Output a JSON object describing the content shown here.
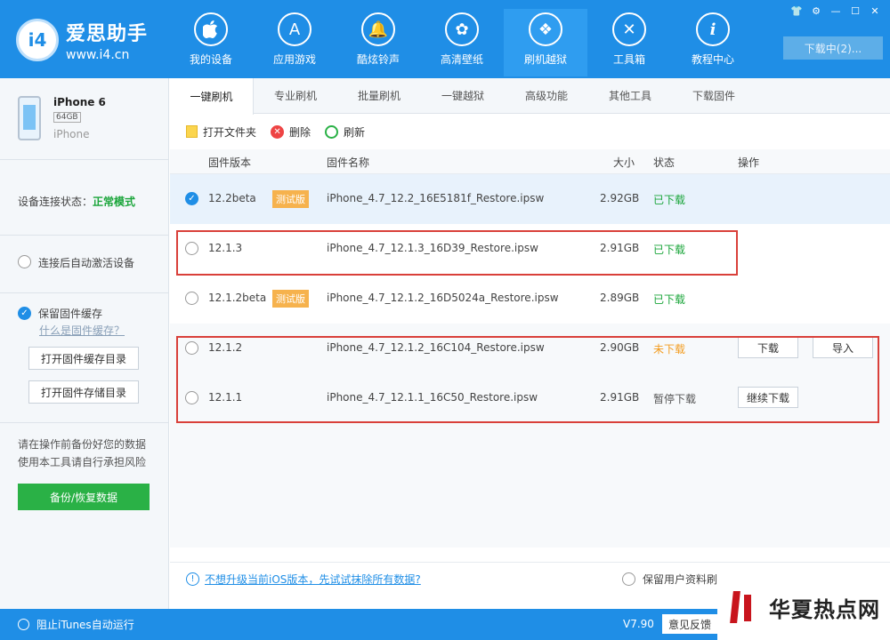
{
  "app": {
    "logo_mark": "i4",
    "logo_title": "爱思助手",
    "logo_url": "www.i4.cn"
  },
  "nav": [
    {
      "label": "我的设备",
      "icon": "apple-icon",
      "glyph": "",
      "active": false
    },
    {
      "label": "应用游戏",
      "icon": "app-store-icon",
      "glyph": "A",
      "active": false
    },
    {
      "label": "酷炫铃声",
      "icon": "bell-icon",
      "glyph": "🔔",
      "active": false
    },
    {
      "label": "高清壁纸",
      "icon": "flower-icon",
      "glyph": "✿",
      "active": false
    },
    {
      "label": "刷机越狱",
      "icon": "dropbox-icon",
      "glyph": "❖",
      "active": true
    },
    {
      "label": "工具箱",
      "icon": "tools-icon",
      "glyph": "✕",
      "active": false
    },
    {
      "label": "教程中心",
      "icon": "info-icon",
      "glyph": "i",
      "active": false
    }
  ],
  "window_controls": [
    "👕",
    "⚙",
    "—",
    "☐",
    "✕"
  ],
  "download_button": "下载中(2)...",
  "device": {
    "name": "iPhone 6",
    "capacity": "64GB",
    "model": "iPhone"
  },
  "connection": {
    "label": "设备连接状态：",
    "value": "正常模式"
  },
  "auto_activate": "连接后自动激活设备",
  "cache": {
    "label": "保留固件缓存",
    "link": "什么是固件缓存？",
    "btn_open_cache": "打开固件缓存目录",
    "btn_open_storage": "打开固件存储目录"
  },
  "warning": [
    "请在操作前备份好您的数据",
    "使用本工具请自行承担风险"
  ],
  "backup_button": "备份/恢复数据",
  "tabs": [
    "一键刷机",
    "专业刷机",
    "批量刷机",
    "一键越狱",
    "高级功能",
    "其他工具",
    "下载固件"
  ],
  "toolbar": {
    "open_folder": "打开文件夹",
    "delete": "删除",
    "refresh": "刷新"
  },
  "columns": {
    "version": "固件版本",
    "name": "固件名称",
    "size": "大小",
    "status": "状态",
    "action": "操作"
  },
  "rows": [
    {
      "version": "12.2beta",
      "beta": "测试版",
      "name": "iPhone_4.7_12.2_16E5181f_Restore.ipsw",
      "size": "2.92GB",
      "status": "已下载",
      "selected": true
    },
    {
      "version": "12.1.3",
      "beta": "",
      "name": "iPhone_4.7_12.1.3_16D39_Restore.ipsw",
      "size": "2.91GB",
      "status": "已下载",
      "selected": false
    },
    {
      "version": "12.1.2beta",
      "beta": "测试版",
      "name": "iPhone_4.7_12.1.2_16D5024a_Restore.ipsw",
      "size": "2.89GB",
      "status": "已下载",
      "selected": false
    },
    {
      "version": "12.1.2",
      "beta": "",
      "name": "iPhone_4.7_12.1.2_16C104_Restore.ipsw",
      "size": "2.90GB",
      "status": "未下载",
      "selected": false,
      "actions": [
        "下载",
        "导入"
      ]
    },
    {
      "version": "12.1.1",
      "beta": "",
      "name": "iPhone_4.7_12.1.1_16C50_Restore.ipsw",
      "size": "2.91GB",
      "status": "暂停下载",
      "selected": false,
      "actions": [
        "继续下载"
      ]
    }
  ],
  "footer": {
    "wipe_link": "不想升级当前iOS版本，先试试抹除所有数据?",
    "keep_data": "保留用户资料刷"
  },
  "statusbar": {
    "itunes": "阻止iTunes自动运行",
    "version": "V7.90",
    "feedback": "意见反馈"
  },
  "watermark": "华夏热点网"
}
